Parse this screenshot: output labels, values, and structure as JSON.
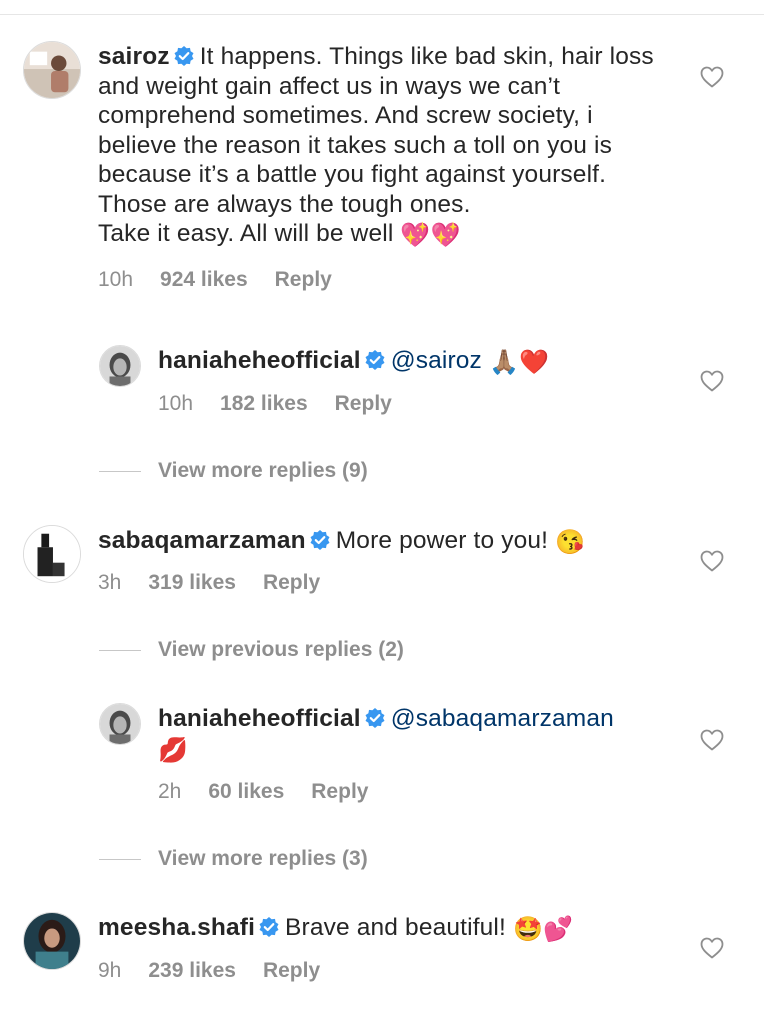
{
  "comments": [
    {
      "username": "sairoz",
      "body": "It happens. Things like bad skin, hair loss and weight gain affect us in ways we can’t comprehend sometimes. And screw society, i believe the reason it takes such a toll on you is because it’s a battle you fight against yourself. Those are always the tough ones.",
      "body_line2": "Take it easy. All will be well",
      "emoji": "💖💖",
      "time": "10h",
      "likes": "924 likes",
      "reply": "Reply"
    },
    {
      "username": "haniaheheofficial",
      "mention": "@sairoz",
      "emoji": "🙏🏽❤️",
      "time": "10h",
      "likes": "182 likes",
      "reply": "Reply"
    },
    {
      "username": "sabaqamarzaman",
      "body": "More power to you!",
      "emoji": "😘",
      "time": "3h",
      "likes": "319 likes",
      "reply": "Reply"
    },
    {
      "username": "haniaheheofficial",
      "mention": "@sabaqamarzaman",
      "emoji": "💋",
      "time": "2h",
      "likes": "60 likes",
      "reply": "Reply"
    },
    {
      "username": "meesha.shafi",
      "body": "Brave and beautiful!",
      "emoji": "🤩💕",
      "time": "9h",
      "likes": "239 likes",
      "reply": "Reply"
    }
  ],
  "threads": {
    "view_more_1": "View more replies (9)",
    "view_previous_2": "View previous replies (2)",
    "view_more_3": "View more replies (3)"
  },
  "colors": {
    "text": "#262626",
    "secondary": "#8e8e8e",
    "mention": "#003569",
    "verified": "#3897f0"
  },
  "icons": {
    "verified": "verified-badge-icon",
    "like": "heart-outline-icon"
  }
}
